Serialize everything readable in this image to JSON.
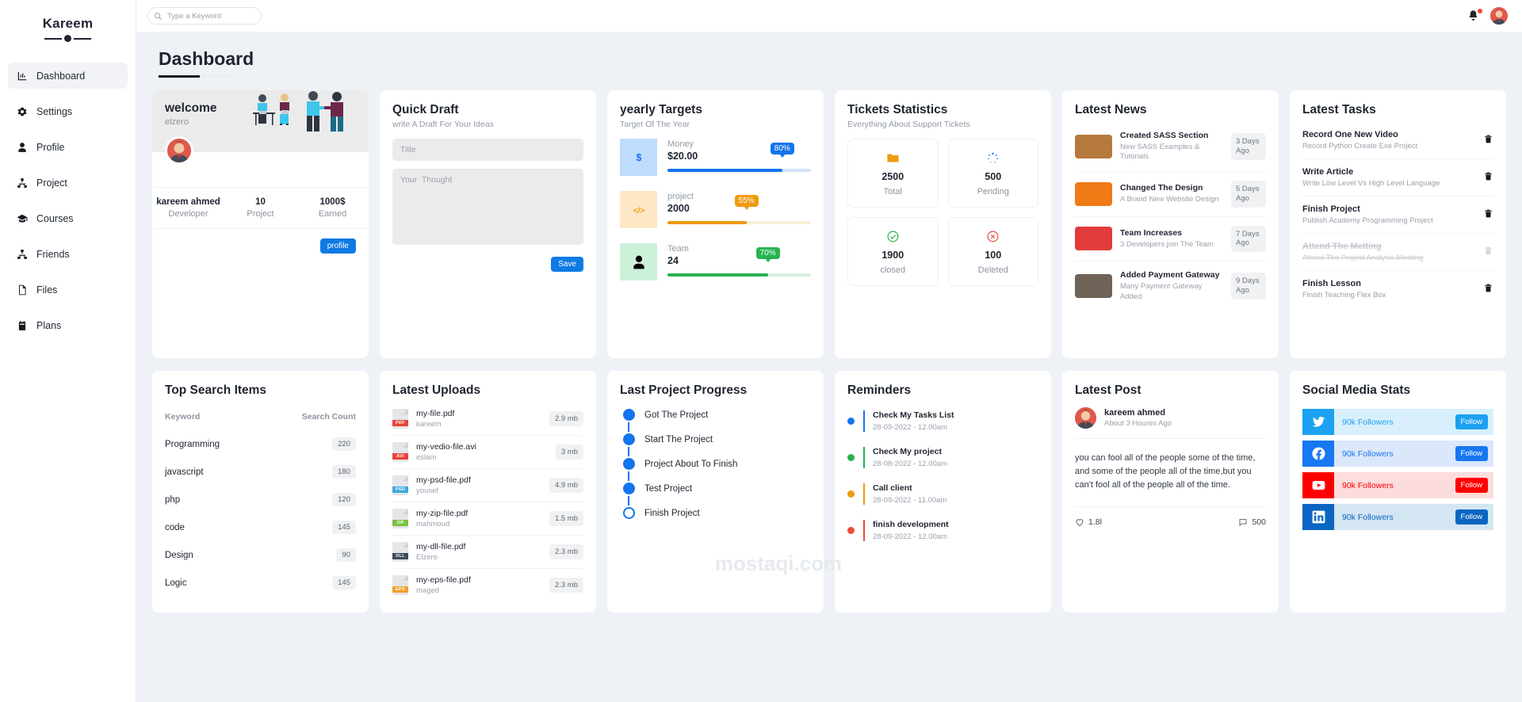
{
  "sidebar": {
    "brand": "Kareem",
    "items": [
      {
        "label": "Dashboard",
        "icon": "chart-bar-icon",
        "active": true
      },
      {
        "label": "Settings",
        "icon": "gear-icon",
        "active": false
      },
      {
        "label": "Profile",
        "icon": "user-icon",
        "active": false
      },
      {
        "label": "Project",
        "icon": "sitemap-icon",
        "active": false
      },
      {
        "label": "Courses",
        "icon": "graduation-cap-icon",
        "active": false
      },
      {
        "label": "Friends",
        "icon": "sitemap-icon",
        "active": false
      },
      {
        "label": "Files",
        "icon": "file-icon",
        "active": false
      },
      {
        "label": "Plans",
        "icon": "calendar-icon",
        "active": false
      }
    ]
  },
  "topbar": {
    "search_placeholder": "Type a Keyword",
    "search_value": "",
    "notification_icon": "bell-icon",
    "avatar_icon": "user-avatar"
  },
  "page": {
    "title": "Dashboard"
  },
  "welcome": {
    "title": "welcome",
    "subtitle": "elzero",
    "stats": [
      {
        "value": "kareem ahmed",
        "label": "Developer"
      },
      {
        "value": "10",
        "label": "Project"
      },
      {
        "value": "1000$",
        "label": "Earned"
      }
    ],
    "button": "profile"
  },
  "quick_draft": {
    "title": "Quick Draft",
    "subtitle": "write A Draft For Your Ideas",
    "title_placeholder": "Title",
    "title_value": "",
    "thought_placeholder": "Your  Thought",
    "thought_value": "",
    "save_label": "Save"
  },
  "yearly_targets": {
    "title": "yearly Targets",
    "subtitle": "Target Of The Year",
    "items": [
      {
        "icon": "dollar-icon",
        "label": "Money",
        "value": "$20.00",
        "percent": "80%",
        "pct": 80,
        "color": "#1474ec",
        "bg": "#bfdcff",
        "track": "#cfe2f9"
      },
      {
        "icon": "code-icon",
        "label": "project",
        "value": "2000",
        "percent": "55%",
        "pct": 55,
        "color": "#ef9b0f",
        "bg": "#fde7c4",
        "track": "#fbeed6"
      },
      {
        "icon": "user-icon",
        "label": "Team",
        "value": "24",
        "percent": "70%",
        "pct": 70,
        "color": "#27b350",
        "bg": "#cdf0d9",
        "track": "#d4f0dd"
      }
    ]
  },
  "tickets": {
    "title": "Tickets Statistics",
    "subtitle": "Everything About Support Tickets",
    "items": [
      {
        "icon": "folder-icon",
        "value": "2500",
        "label": "Total",
        "color": "#ef9b0f"
      },
      {
        "icon": "spinner-icon",
        "value": "500",
        "label": "Pending",
        "color": "#1474ec"
      },
      {
        "icon": "check-circle-icon",
        "value": "1900",
        "label": "closed",
        "color": "#27b350"
      },
      {
        "icon": "times-circle-icon",
        "value": "100",
        "label": "Deleted",
        "color": "#e74c3c"
      }
    ]
  },
  "latest_news": {
    "title": "Latest News",
    "items": [
      {
        "title": "Created SASS Section",
        "desc": "New SASS Examples & Tutorials",
        "time": "3 Days Ago",
        "thumb": "#b5793e"
      },
      {
        "title": "Changed The Design",
        "desc": "A Brand New Website Design",
        "time": "5 Days Ago",
        "thumb": "#f07a16"
      },
      {
        "title": "Team Increases",
        "desc": "3 Developers join The Team",
        "time": "7 Days Ago",
        "thumb": "#e23b3b"
      },
      {
        "title": "Added Payment Gateway",
        "desc": "Many Payment Gateway Added",
        "time": "9 Days Ago",
        "thumb": "#6f6256"
      }
    ]
  },
  "latest_tasks": {
    "title": "Latest Tasks",
    "items": [
      {
        "title": "Record One New Video",
        "desc": "Record Python Create Exe Project",
        "done": false
      },
      {
        "title": "Write Article",
        "desc": "Write Low Level Vs High Level Language",
        "done": false
      },
      {
        "title": "Finish Project",
        "desc": "Publish Academy Programming Project",
        "done": false
      },
      {
        "title": "Attend The Metting",
        "desc": "Attend The Project Analysis Meeting",
        "done": true
      },
      {
        "title": "Finish Lesson",
        "desc": "Finish Teaching Flex Box",
        "done": false
      }
    ]
  },
  "top_search": {
    "title": "Top Search Items",
    "col_keyword": "Keyword",
    "col_count": "Search Count",
    "rows": [
      {
        "keyword": "Programming",
        "count": "220"
      },
      {
        "keyword": "javascript",
        "count": "180"
      },
      {
        "keyword": "php",
        "count": "120"
      },
      {
        "keyword": "code",
        "count": "145"
      },
      {
        "keyword": "Design",
        "count": "90"
      },
      {
        "keyword": "Logic",
        "count": "145"
      }
    ]
  },
  "latest_uploads": {
    "title": "Latest Uploads",
    "items": [
      {
        "name": "my-file.pdf",
        "user": "kareem",
        "size": "2.9 mb",
        "ext": "PDF",
        "color": "#e8443a"
      },
      {
        "name": "my-vedio-file.avi",
        "user": "eslam",
        "size": "3 mb",
        "ext": "AVI",
        "color": "#e8443a"
      },
      {
        "name": "my-psd-file.pdf",
        "user": "yousef",
        "size": "4.9 mb",
        "ext": "PSD",
        "color": "#3fa8e0"
      },
      {
        "name": "my-zip-file.pdf",
        "user": "mahmoud",
        "size": "1.5 mb",
        "ext": "ZIP",
        "color": "#7bc043"
      },
      {
        "name": "my-dll-file.pdf",
        "user": "Elzero",
        "size": "2.3 mb",
        "ext": "DLL",
        "color": "#3b4b5c"
      },
      {
        "name": "my-eps-file.pdf",
        "user": "maged",
        "size": "2.3 mb",
        "ext": "EPS",
        "color": "#f0a02a"
      }
    ]
  },
  "project_progress": {
    "title": "Last Project Progress",
    "steps": [
      {
        "label": "Got The Project",
        "done": true
      },
      {
        "label": "Start The Project",
        "done": true
      },
      {
        "label": "Project About To Finish",
        "done": true
      },
      {
        "label": "Test Project",
        "done": true
      },
      {
        "label": "Finish Project",
        "done": false
      }
    ]
  },
  "reminders": {
    "title": "Reminders",
    "items": [
      {
        "title": "Check My Tasks List",
        "date": "28-09-2022 - 12.00am",
        "color": "#1474ec"
      },
      {
        "title": "Check My project",
        "date": "28-08-2022 - 12.00am",
        "color": "#27b350"
      },
      {
        "title": "Call client",
        "date": "28-09-2022 - 11.00am",
        "color": "#ef9b0f"
      },
      {
        "title": "finish development",
        "date": "28-09-2022 - 12.00am",
        "color": "#e74c3c"
      }
    ]
  },
  "latest_post": {
    "title": "Latest Post",
    "author": "kareem ahmed",
    "time": "About 3 Houres Ago",
    "body": "you can fool all of the people some of the time, and some of the people all of the time,but you can't fool all of the people all of the time.",
    "likes": "1.8l",
    "comments": "500"
  },
  "social": {
    "title": "Social Media Stats",
    "items": [
      {
        "network": "twitter-icon",
        "count": "90k Followers",
        "button": "Follow",
        "color": "#1da1f2",
        "bg": "#d9f0fc",
        "text": "#1da1f2"
      },
      {
        "network": "facebook-icon",
        "count": "90k Followers",
        "button": "Follow",
        "color": "#1877f2",
        "bg": "#dbe7fb",
        "text": "#1877f2"
      },
      {
        "network": "youtube-icon",
        "count": "90k Followers",
        "button": "Follow",
        "color": "#ff0000",
        "bg": "#fcdcdc",
        "text": "#ff0000"
      },
      {
        "network": "linkedin-icon",
        "count": "90k Followers",
        "button": "Follow",
        "color": "#0a66c2",
        "bg": "#d3e6f2",
        "text": "#0a66c2"
      }
    ]
  },
  "watermark": "mostaqi.com"
}
